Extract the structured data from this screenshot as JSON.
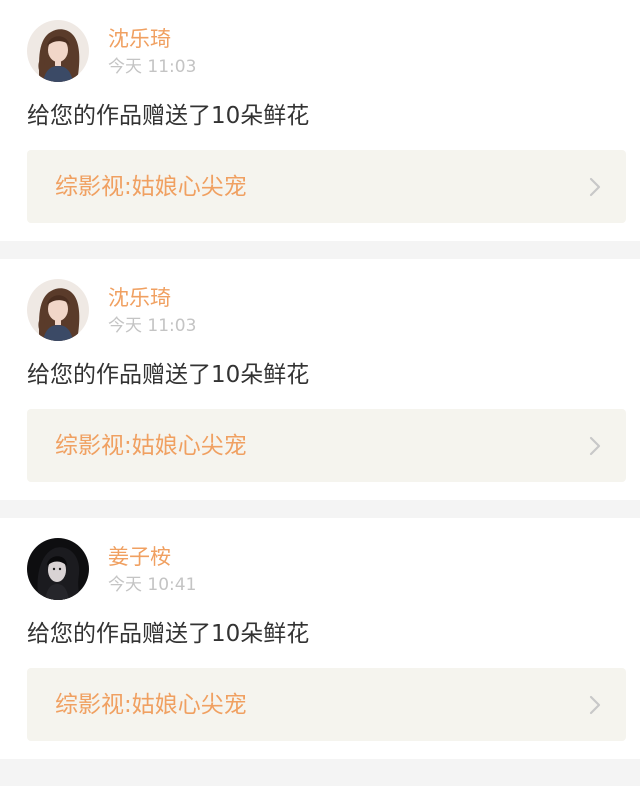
{
  "notifications": [
    {
      "user": "沈乐琦",
      "time": "今天 11:03",
      "message": "给您的作品赠送了10朵鲜花",
      "work_title": "综影视:姑娘心尖宠",
      "avatar_icon": "curly-hair-girl-avatar"
    },
    {
      "user": "沈乐琦",
      "time": "今天 11:03",
      "message": "给您的作品赠送了10朵鲜花",
      "work_title": "综影视:姑娘心尖宠",
      "avatar_icon": "curly-hair-girl-avatar"
    },
    {
      "user": "姜子桉",
      "time": "今天 10:41",
      "message": "给您的作品赠送了10朵鲜花",
      "work_title": "综影视:姑娘心尖宠",
      "avatar_icon": "dark-haired-girl-avatar"
    }
  ],
  "colors": {
    "accent": "#f0a061",
    "timestamp": "#c4c4c4",
    "text": "#333333",
    "link_bg": "#f5f4ee",
    "page_bg": "#f4f4f4"
  },
  "icons": {
    "chevron": "chevron-right-icon"
  }
}
